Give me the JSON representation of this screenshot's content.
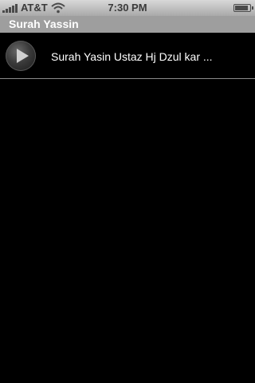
{
  "status_bar": {
    "carrier": "AT&T",
    "time": "7:30 PM",
    "battery_level": 0.9,
    "icons": [
      "signal-icon",
      "wifi-icon",
      "battery-icon"
    ]
  },
  "title_bar": {
    "title": "Surah Yassin"
  },
  "list": {
    "items": [
      {
        "title": "Surah Yasin Ustaz Hj Dzul kar ...",
        "icon": "play-icon"
      }
    ]
  },
  "colors": {
    "background": "#000000",
    "title_bar": "#9e9e9e",
    "text": "#ffffff",
    "separator": "#8a8a8a"
  }
}
